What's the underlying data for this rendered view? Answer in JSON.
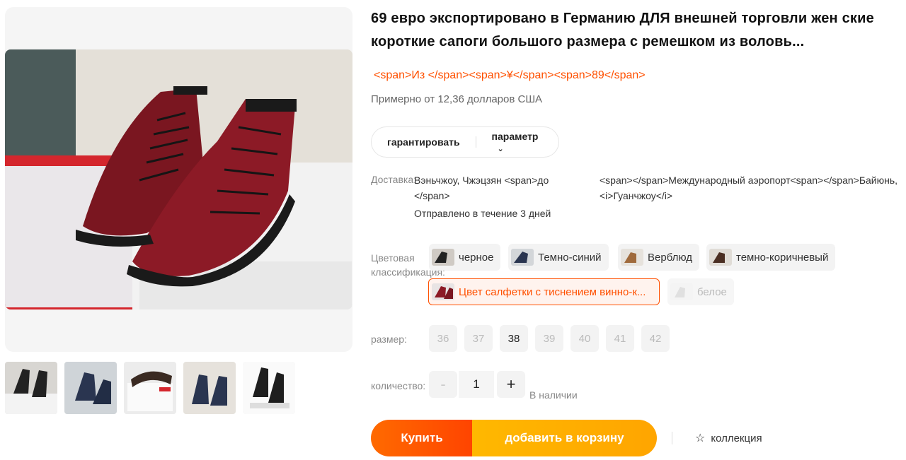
{
  "product": {
    "title": "69 евро экспортировано в Германию ДЛЯ внешней торговли жен ские короткие сапоги большого размера с ремешком из воловь...",
    "price_text": "<span>Из </span><span>¥</span><span>89</span>",
    "approx_price": "Примерно от 12,36 долларов США"
  },
  "tabs": {
    "guarantee": "гарантировать",
    "params": "параметр"
  },
  "delivery": {
    "label": "Доставка:",
    "origin_line1": "Вэньчжоу, Чжэцзян <span>до",
    "origin_line2": "</span>",
    "destination": "<span></span>Международный аэропорт<span></span>Байюнь, <i>Гуанчжоу</i>",
    "shipping_time": "Отправлено в течение 3 дней"
  },
  "color": {
    "label": "Цветовая классификация:",
    "options": [
      {
        "label": "черное",
        "state": "normal"
      },
      {
        "label": "Темно-синий",
        "state": "normal"
      },
      {
        "label": "Верблюд",
        "state": "normal"
      },
      {
        "label": "темно-коричневый",
        "state": "normal"
      },
      {
        "label": "Цвет салфетки с тиснением винно-к...",
        "state": "selected"
      },
      {
        "label": "белое",
        "state": "disabled"
      }
    ]
  },
  "size": {
    "label": "размер:",
    "options": [
      "36",
      "37",
      "38",
      "39",
      "40",
      "41",
      "42"
    ],
    "available": "38"
  },
  "quantity": {
    "label": "количество:",
    "value": "1",
    "minus": "-",
    "plus": "+",
    "stock": "В наличии"
  },
  "actions": {
    "buy": "Купить",
    "add_to_cart": "добавить в корзину",
    "favorite": "коллекция"
  },
  "colors": {
    "accent": "#ff5000",
    "buy_gradient_start": "#ff6a00",
    "cart_gradient": "#ffb800"
  },
  "icons": {
    "favorite": "star-icon",
    "params_dropdown": "chevron-down-icon"
  }
}
